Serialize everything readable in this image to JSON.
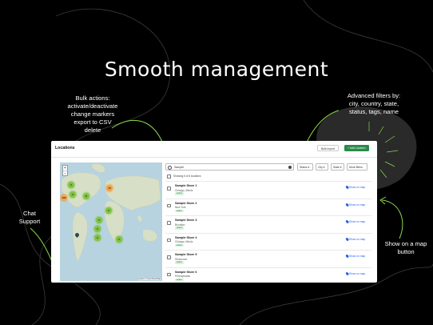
{
  "headline": "Smooth management",
  "annotations": {
    "bulk": [
      "Bulk actions:",
      "activate/deactivate",
      "change markers",
      "export to CSV",
      "delete"
    ],
    "filters": [
      "Advanced filters by:",
      "city, country, state,",
      "status, tags, name"
    ],
    "chat": [
      "Chat",
      "Support"
    ],
    "show_on_map": [
      "Show on a map",
      "button"
    ]
  },
  "app": {
    "title": "Locations",
    "bulk_import_label": "Bulk import",
    "add_location_label": "+ Add Location",
    "map": {
      "zoom_in": "+",
      "zoom_out": "−",
      "attribution": "Leaflet | © OpenStreetMap",
      "clusters": [
        "2",
        "15",
        "3",
        "100",
        "8",
        "2",
        "2",
        "2",
        "2",
        "2"
      ]
    },
    "search": {
      "value": "Sample"
    },
    "filters": [
      "Status ▾",
      "City ▾",
      "State ▾",
      "More filters"
    ],
    "showing": "Showing 6 of 6 locations",
    "stores": [
      {
        "name": "Sample Store 1",
        "city": "Chicago, Illinois",
        "status": "active",
        "show": "Show on map"
      },
      {
        "name": "Sample Store 2",
        "city": "New York",
        "status": "active",
        "show": "Show on map"
      },
      {
        "name": "Sample Store 3",
        "city": "Brooklyn",
        "status": "active",
        "show": "Show on map"
      },
      {
        "name": "Sample Store 4",
        "city": "Chicago, Illinois",
        "status": "active",
        "show": "Show on map"
      },
      {
        "name": "Sample Store 5",
        "city": "Showroom",
        "status": "active",
        "show": "Show on map"
      },
      {
        "name": "Sample Store 6",
        "city": "Pennsylvania",
        "status": "active",
        "show": "Show on map"
      }
    ]
  },
  "colors": {
    "background": "#000000",
    "accent_green": "#8bd94a",
    "primary_button": "#2a8a4a",
    "link_blue": "#2563eb",
    "cluster_green": "#7fc241",
    "cluster_orange": "#f0a34a"
  }
}
